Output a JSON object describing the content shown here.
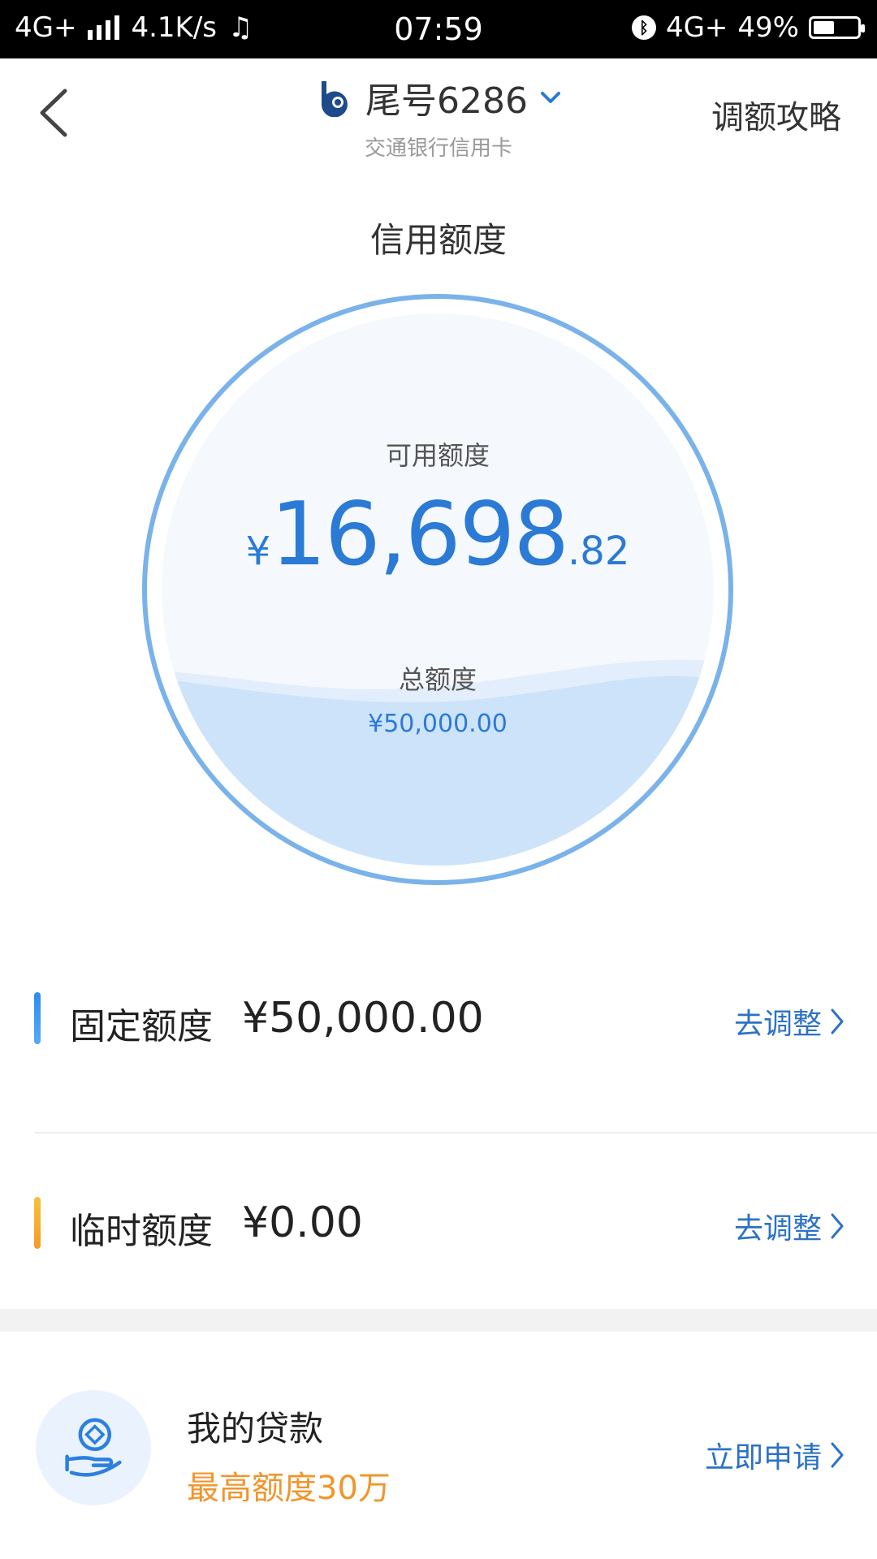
{
  "status_bar": {
    "network": "4G+",
    "speed": "4.1K/s",
    "time": "07:59",
    "network_right": "4G+",
    "battery": "49%",
    "battery_fraction": 0.49
  },
  "header": {
    "card_title": "尾号6286",
    "subtitle": "交通银行信用卡",
    "right_link": "调额攻略"
  },
  "section_title": "信用额度",
  "gauge": {
    "available_label": "可用额度",
    "currency": "¥",
    "available_int": "16,698",
    "available_dec": ".82",
    "total_label": "总额度",
    "total_value": "¥50,000.00",
    "fill_fraction": 0.33
  },
  "rows": [
    {
      "label": "固定额度",
      "value": "¥50,000.00",
      "action": "去调整",
      "color": "#2d8cf0"
    },
    {
      "label": "临时额度",
      "value": "¥0.00",
      "action": "去调整",
      "color": "#f5b326"
    }
  ],
  "loan": {
    "title": "我的贷款",
    "subtitle": "最高额度30万",
    "action": "立即申请"
  },
  "colors": {
    "accent_blue": "#2b7ad6",
    "link_blue": "#2b72c6",
    "orange": "#f0962c",
    "gauge_ring": "#7ab2ea"
  }
}
